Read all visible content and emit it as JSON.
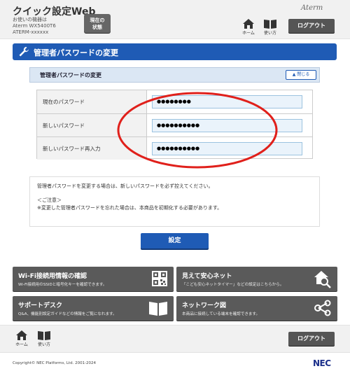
{
  "header": {
    "title": "クイック設定Web",
    "device_line1": "お使いの機器は",
    "device_line2": "Aterm WX5400T6",
    "device_line3": "ATERM-xxxxxx",
    "status_button_line1": "現在の",
    "status_button_line2": "状態",
    "brand": "Aterm",
    "home_label": "ホーム",
    "help_label": "使い方",
    "logout_label": "ログアウト"
  },
  "banner": {
    "title": "管理者パスワードの変更",
    "icon": "wrench-icon"
  },
  "section": {
    "title": "管理者パスワードの変更",
    "close_label": "閉じる"
  },
  "form": {
    "rows": [
      {
        "label": "現在のパスワード",
        "value": "●●●●●●●●"
      },
      {
        "label": "新しいパスワード",
        "value": "●●●●●●●●●●"
      },
      {
        "label": "新しいパスワード再入力",
        "value": "●●●●●●●●●●"
      }
    ]
  },
  "info": {
    "line1": "管理者パスワードを変更する場合は、新しいパスワードを必ず控えてください。",
    "line2": "＜ご注意＞",
    "line3": "※変更した管理者パスワードを忘れた場合は、本商品を初期化する必要があります。"
  },
  "set_button_label": "設定",
  "tiles": [
    {
      "title": "Wi-Fi接続用情報の確認",
      "desc": "Wi-Fi接続用のSSIDと暗号化キーを確認できます。",
      "icon": "qr-code-icon"
    },
    {
      "title": "見えて安心ネット",
      "desc": "「こども安心ネットタイマー」などの設定はこちらから。",
      "icon": "home-search-icon"
    },
    {
      "title": "サポートデスク",
      "desc": "Q&A、機能別設定ガイドなどの情報をご覧になれます。",
      "icon": "book-icon"
    },
    {
      "title": "ネットワーク図",
      "desc": "本商品に接続している端末を確認できます。",
      "icon": "network-icon"
    }
  ],
  "footer": {
    "home_label": "ホーム",
    "help_label": "使い方",
    "logout_label": "ログアウト",
    "copyright": "Copyright© NEC Platforms, Ltd. 2001-2024",
    "logo": "NEC"
  },
  "colors": {
    "accent_blue": "#1f5bb5",
    "tile_gray": "#5a5a5a",
    "annotation_red": "#e0201b"
  }
}
